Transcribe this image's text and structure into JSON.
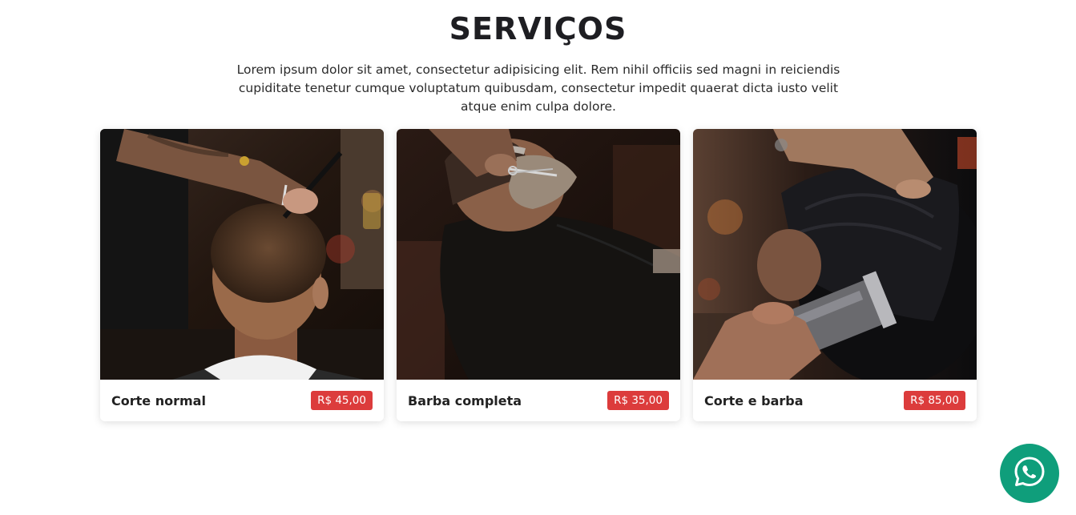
{
  "section": {
    "title": "SERVIÇOS",
    "intro": "Lorem ipsum dolor sit amet, consectetur adipisicing elit. Rem nihil officiis sed magni in reiciendis cupiditate tenetur cumque voluptatum quibusdam, consectetur impedit quaerat dicta iusto velit atque enim culpa dolore."
  },
  "services": [
    {
      "name": "Corte normal",
      "price": "R$ 45,00",
      "image": "haircut-photo"
    },
    {
      "name": "Barba completa",
      "price": "R$ 35,00",
      "image": "beard-trim-photo"
    },
    {
      "name": "Corte e barba",
      "price": "R$ 85,00",
      "image": "clipper-haircut-photo"
    }
  ],
  "floating": {
    "icon": "whatsapp-icon"
  },
  "colors": {
    "price_badge": "#dc3c3c",
    "whatsapp": "#0f9e7b",
    "title": "#1e1e22"
  }
}
